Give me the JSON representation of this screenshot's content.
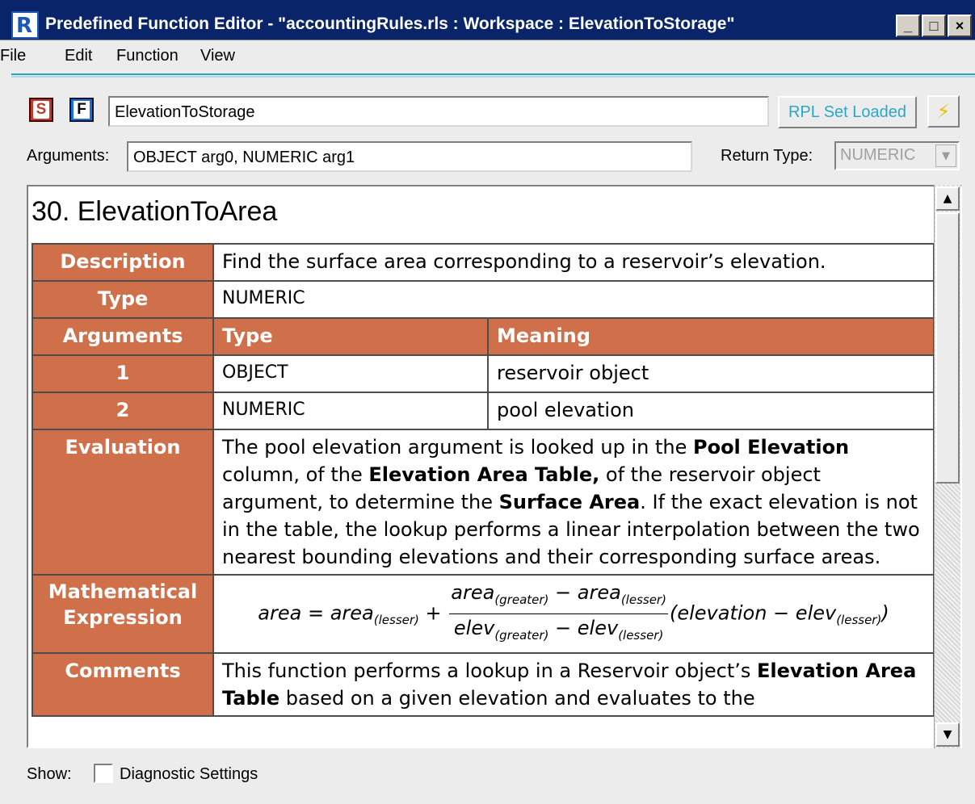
{
  "window": {
    "title": "Predefined Function Editor - \"accountingRules.rls : Workspace : ElevationToStorage\"",
    "minimize": "_",
    "maximize": "□",
    "close": "×"
  },
  "menu": {
    "items": [
      "File",
      "Edit",
      "Function",
      "View"
    ]
  },
  "toolbar": {
    "s_label": "S",
    "f_label": "F",
    "function_name": "ElevationToStorage",
    "rpl_set_label": "RPL Set Loaded",
    "lightning": "⚡"
  },
  "signature": {
    "arguments_label": "Arguments:",
    "arguments_value": "OBJECT arg0, NUMERIC arg1",
    "return_type_label": "Return Type:",
    "return_type_value": "NUMERIC"
  },
  "doc": {
    "title": "30.  ElevationToArea",
    "description_label": "Description",
    "description": "Find the surface area corresponding to a reservoir’s elevation.",
    "type_label": "Type",
    "type_value": "NUMERIC",
    "arguments_label": "Arguments",
    "arg_type_header": "Type",
    "arg_meaning_header": "Meaning",
    "args": [
      {
        "num": "1",
        "type": "OBJECT",
        "meaning": "reservoir object"
      },
      {
        "num": "2",
        "type": "NUMERIC",
        "meaning": "pool elevation"
      }
    ],
    "evaluation_label": "Evaluation",
    "evaluation": {
      "t1": "The pool elevation argument is looked up in the ",
      "b1": "Pool Elevation",
      "t2": " column, of the ",
      "b2": "Elevation Area Table,",
      "t3": "  of the reservoir object argument, to determine the ",
      "b3": "Surface Area",
      "t4": ". If the exact elevation is not in the table, the lookup performs a linear interpolation between the two nearest bounding elevations and their corresponding surface areas."
    },
    "math_label": "Mathematical Expression",
    "math": {
      "lhs": "area",
      "eq": " = ",
      "a": "area",
      "lesser": "(lesser)",
      "greater": "(greater)",
      "plus": " + ",
      "num_a": "area",
      "minus": " − ",
      "num_b": "area",
      "den_a": "elev",
      "den_b": "elev",
      "tail_open": "(elevation",
      "tail_minus": " − ",
      "tail_elev": "elev",
      "tail_close": ")"
    },
    "comments_label": "Comments",
    "comments": {
      "t1": "This function performs a lookup in a Reservoir object’s ",
      "b1": "Elevation Area Table",
      "t2": " based on a given elevation and evaluates to the"
    }
  },
  "footer": {
    "show_label": "Show:",
    "diagnostic_label": "Diagnostic Settings"
  }
}
